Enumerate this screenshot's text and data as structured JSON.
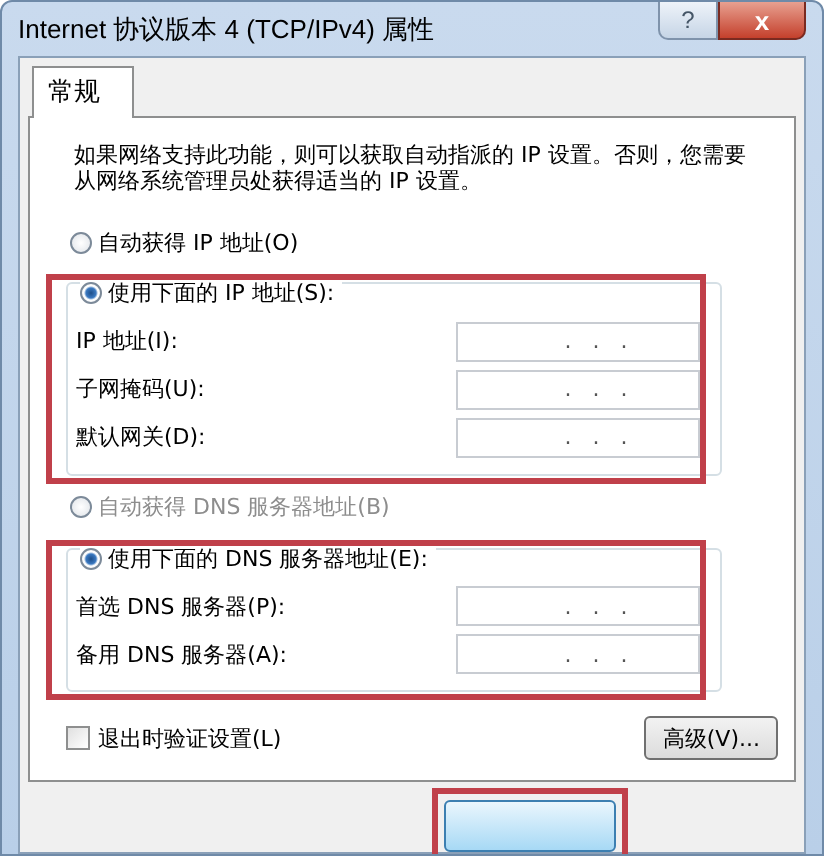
{
  "window": {
    "title": "Internet 协议版本 4 (TCP/IPv4) 属性",
    "help_button": "?",
    "close_button": "x"
  },
  "tabs": [
    {
      "label": "常规",
      "selected": true
    }
  ],
  "description": "如果网络支持此功能，则可以获取自动指派的 IP 设置。否则，您需要从网络系统管理员处获得适当的 IP 设置。",
  "ip_section": {
    "auto_option": {
      "label": "自动获得 IP 地址(O)",
      "selected": false,
      "disabled": false
    },
    "manual_option": {
      "label": "使用下面的 IP 地址(S):",
      "selected": true,
      "disabled": false
    },
    "highlighted": true,
    "fields": [
      {
        "label": "IP 地址(I):",
        "value": ".   .   ."
      },
      {
        "label": "子网掩码(U):",
        "value": ".   .   ."
      },
      {
        "label": "默认网关(D):",
        "value": ".   .   ."
      }
    ]
  },
  "dns_section": {
    "auto_option": {
      "label": "自动获得 DNS 服务器地址(B)",
      "selected": false,
      "disabled": true
    },
    "manual_option": {
      "label": "使用下面的 DNS 服务器地址(E):",
      "selected": true,
      "disabled": false
    },
    "highlighted": true,
    "fields": [
      {
        "label": "首选 DNS 服务器(P):",
        "value": ".   .   ."
      },
      {
        "label": "备用 DNS 服务器(A):",
        "value": ".   .   ."
      }
    ]
  },
  "validate_checkbox": {
    "label": "退出时验证设置(L)",
    "checked": false
  },
  "advanced_button": "高级(V)...",
  "footer_button": {
    "highlighted": true
  }
}
